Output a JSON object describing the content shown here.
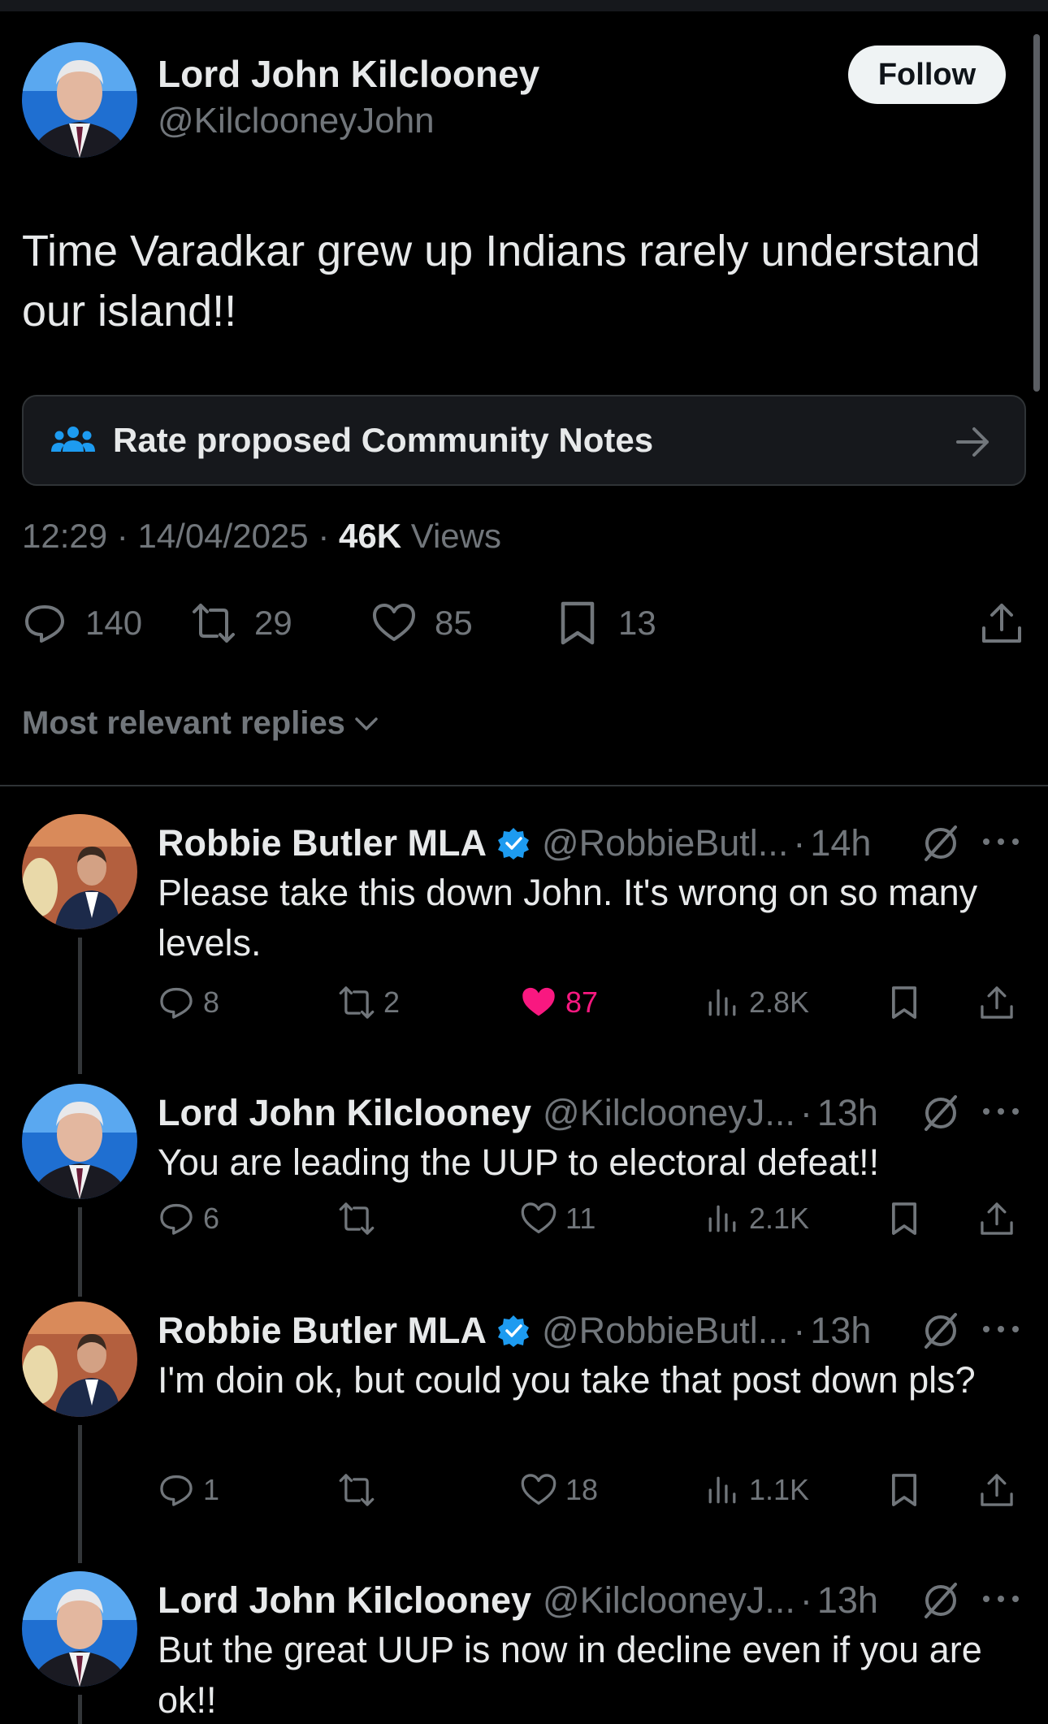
{
  "main_tweet": {
    "author_name": "Lord John Kilclooney",
    "author_handle": "@KilclooneyJohn",
    "follow_label": "Follow",
    "text": "Time Varadkar grew up Indians rarely understand our island!!",
    "community_notes_label": "Rate proposed Community Notes",
    "time": "12:29",
    "date": "14/04/2025",
    "views_count": "46K",
    "views_label": "Views",
    "replies": "140",
    "reposts": "29",
    "likes": "85",
    "bookmarks": "13"
  },
  "replies_filter_label": "Most relevant replies",
  "replies": [
    {
      "author_name": "Robbie Butler MLA",
      "verified": true,
      "author_handle": "@RobbieButl...",
      "age": "14h",
      "text": "Please take this down John. It's wrong on so many levels.",
      "replies": "8",
      "reposts": "2",
      "likes": "87",
      "liked": true,
      "views": "2.8K"
    },
    {
      "author_name": "Lord John Kilclooney",
      "verified": false,
      "author_handle": "@KilclooneyJ...",
      "age": "13h",
      "text": "You are leading the UUP to electoral defeat!!",
      "replies": "6",
      "reposts": "",
      "likes": "11",
      "liked": false,
      "views": "2.1K"
    },
    {
      "author_name": "Robbie Butler MLA",
      "verified": true,
      "author_handle": "@RobbieButl...",
      "age": "13h",
      "text": "I'm doin ok, but could you take that post down pls?",
      "replies": "1",
      "reposts": "",
      "likes": "18",
      "liked": false,
      "views": "1.1K"
    },
    {
      "author_name": "Lord John Kilclooney",
      "verified": false,
      "author_handle": "@KilclooneyJ...",
      "age": "13h",
      "text": "But the great UUP is now in decline even if you are ok!!"
    }
  ],
  "colors": {
    "background": "#000000",
    "text_primary": "#e7e9ea",
    "text_secondary": "#71767b",
    "like_active": "#f91880",
    "verified_badge": "#1d9bf0",
    "follow_button_bg": "#eff3f4"
  },
  "icons": {
    "reply": "speech-bubble-icon",
    "repost": "repost-icon",
    "like": "heart-icon",
    "views": "bar-chart-icon",
    "bookmark": "bookmark-icon",
    "share": "share-icon",
    "grok": "grok-icon",
    "more": "more-dots-icon",
    "community_notes": "people-icon",
    "arrow": "arrow-right-icon",
    "verified": "verified-badge-icon"
  }
}
